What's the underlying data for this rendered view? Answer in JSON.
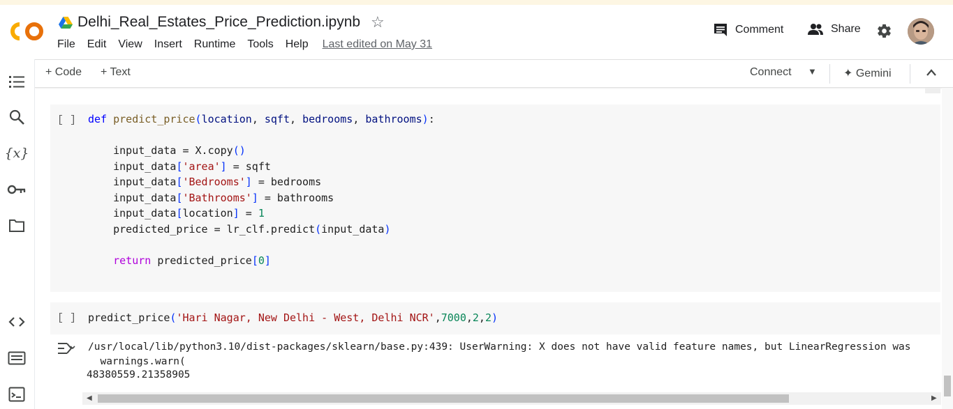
{
  "header": {
    "title": "Delhi_Real_Estates_Price_Prediction.ipynb",
    "menu": [
      "File",
      "Edit",
      "View",
      "Insert",
      "Runtime",
      "Tools",
      "Help"
    ],
    "last_edited": "Last edited on May 31",
    "comment_label": "Comment",
    "share_label": "Share"
  },
  "toolbar": {
    "add_code": "+ Code",
    "add_text": "+ Text",
    "connect": "Connect",
    "gemini": "Gemini"
  },
  "cells": [
    {
      "run_label": "[ ]",
      "lines": [
        [
          {
            "t": "def",
            "c": "kw"
          },
          {
            "t": " "
          },
          {
            "t": "predict_price",
            "c": "fn"
          },
          {
            "t": "(",
            "c": "bk"
          },
          {
            "t": "location",
            "c": "pm"
          },
          {
            "t": ", "
          },
          {
            "t": "sqft",
            "c": "pm"
          },
          {
            "t": ", "
          },
          {
            "t": "bedrooms",
            "c": "pm"
          },
          {
            "t": ", "
          },
          {
            "t": "bathrooms",
            "c": "pm"
          },
          {
            "t": ")",
            "c": "bk"
          },
          {
            "t": ":"
          }
        ],
        [],
        [
          {
            "t": "    input_data = X.copy"
          },
          {
            "t": "()",
            "c": "bk"
          }
        ],
        [
          {
            "t": "    input_data"
          },
          {
            "t": "[",
            "c": "bk"
          },
          {
            "t": "'area'",
            "c": "st"
          },
          {
            "t": "]",
            "c": "bk"
          },
          {
            "t": " = sqft"
          }
        ],
        [
          {
            "t": "    input_data"
          },
          {
            "t": "[",
            "c": "bk"
          },
          {
            "t": "'Bedrooms'",
            "c": "st"
          },
          {
            "t": "]",
            "c": "bk"
          },
          {
            "t": " = bedrooms"
          }
        ],
        [
          {
            "t": "    input_data"
          },
          {
            "t": "[",
            "c": "bk"
          },
          {
            "t": "'Bathrooms'",
            "c": "st"
          },
          {
            "t": "]",
            "c": "bk"
          },
          {
            "t": " = bathrooms"
          }
        ],
        [
          {
            "t": "    input_data"
          },
          {
            "t": "[",
            "c": "bk"
          },
          {
            "t": "location"
          },
          {
            "t": "]",
            "c": "bk"
          },
          {
            "t": " = "
          },
          {
            "t": "1",
            "c": "nm"
          }
        ],
        [
          {
            "t": "    predicted_price = lr_clf.predict"
          },
          {
            "t": "(",
            "c": "bk"
          },
          {
            "t": "input_data"
          },
          {
            "t": ")",
            "c": "bk"
          }
        ],
        [],
        [
          {
            "t": "    "
          },
          {
            "t": "return",
            "c": "kw2"
          },
          {
            "t": " predicted_price"
          },
          {
            "t": "[",
            "c": "bk"
          },
          {
            "t": "0",
            "c": "nm"
          },
          {
            "t": "]",
            "c": "bk"
          }
        ]
      ]
    },
    {
      "run_label": "[ ]",
      "lines": [
        [
          {
            "t": "predict_price"
          },
          {
            "t": "(",
            "c": "bk"
          },
          {
            "t": "'Hari Nagar, New Delhi - West, Delhi NCR'",
            "c": "st"
          },
          {
            "t": ","
          },
          {
            "t": "7000",
            "c": "nm"
          },
          {
            "t": ","
          },
          {
            "t": "2",
            "c": "nm"
          },
          {
            "t": ","
          },
          {
            "t": "2",
            "c": "nm"
          },
          {
            "t": ")",
            "c": "bk"
          }
        ]
      ]
    }
  ],
  "output": {
    "warning_line": "/usr/local/lib/python3.10/dist-packages/sklearn/base.py:439: UserWarning: X does not have valid feature names, but LinearRegression was",
    "warn_call": "  warnings.warn(",
    "result": "48380559.21358905"
  }
}
